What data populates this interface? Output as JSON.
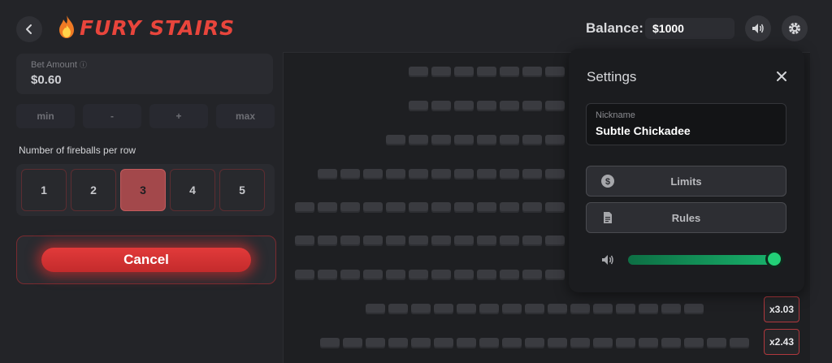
{
  "header": {
    "logo_text": "FURY STAIRS",
    "balance_label": "Balance:",
    "balance_value": "$1000"
  },
  "bet": {
    "label": "Bet Amount",
    "value": "$0.60",
    "buttons": [
      "min",
      "-",
      "+",
      "max"
    ]
  },
  "fireballs": {
    "label": "Number of fireballs per row",
    "options": [
      "1",
      "2",
      "3",
      "4",
      "5"
    ],
    "selected": "3"
  },
  "cancel_label": "Cancel",
  "board": {
    "rows": [
      {
        "tiles": 7
      },
      {
        "tiles": 7
      },
      {
        "tiles": 8
      },
      {
        "tiles": 11
      },
      {
        "tiles": 12
      },
      {
        "tiles": 12
      },
      {
        "tiles": 12
      },
      {
        "tiles": 15
      },
      {
        "tiles": 19
      }
    ],
    "multipliers": [
      "x3.03",
      "x2.43"
    ]
  },
  "settings": {
    "title": "Settings",
    "nickname_label": "Nickname",
    "nickname_value": "Subtle Chickadee",
    "limits_label": "Limits",
    "rules_label": "Rules",
    "volume_percent": 100
  },
  "colors": {
    "accent": "#e23a3a",
    "selected_fire": "#a3484b",
    "volume": "#22d177"
  }
}
